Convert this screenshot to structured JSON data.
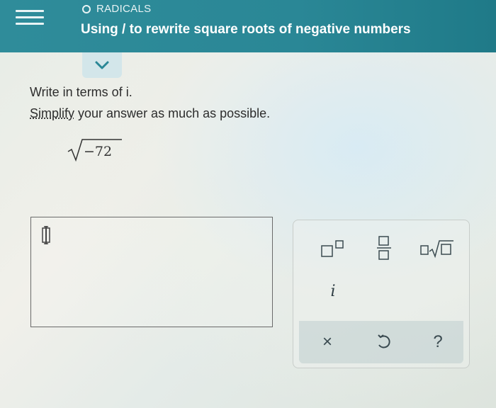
{
  "header": {
    "topic": "RADICALS",
    "title": "Using / to rewrite square roots of negative numbers"
  },
  "instructions": {
    "line1": "Write in terms of i.",
    "simplify_link": "Simplify",
    "line2_rest": " your answer as much as possible."
  },
  "problem": {
    "radicand": "−72"
  },
  "keypad": {
    "imaginary_unit": "i",
    "clear": "×",
    "help": "?"
  },
  "icons": [
    "menu-icon",
    "circle-icon",
    "chevron-down-icon",
    "superscript-icon",
    "fraction-icon",
    "nth-root-icon",
    "undo-icon",
    "text-cursor-icon"
  ],
  "colors": {
    "header": "#2f8c9a",
    "tab": "#d3e6ea"
  }
}
